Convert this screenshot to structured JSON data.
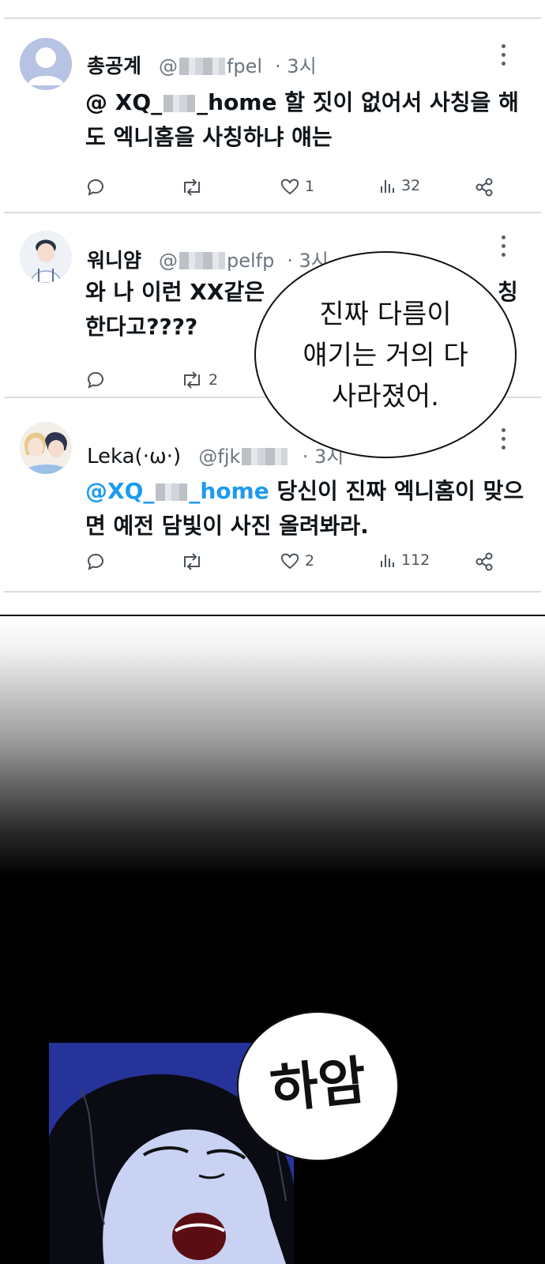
{
  "tweets": [
    {
      "name": "총공계",
      "handle_prefix": "@",
      "handle_suffix": "fpel",
      "time": "· 3시",
      "text_prefix": "@ XQ_",
      "text_mention_suffix": "_home",
      "text_body": " 할 짓이 없어서 사칭을 해도 엑니홈을 사칭하냐 얘는",
      "replies": "",
      "retweets": "",
      "likes": "1",
      "views": "32"
    },
    {
      "name": "워니얌",
      "handle_prefix": "@",
      "handle_suffix": "pelfp",
      "time": "· 3시",
      "text_line1": "와 나 이런 XX같은 ",
      "text_line1_end": "칭",
      "text_line2": "한다고????",
      "replies": "",
      "retweets": "2",
      "likes": "",
      "views": ""
    },
    {
      "name": "Leka(·ω·)",
      "handle_prefix": "@fjk",
      "handle_suffix": "",
      "time": "· 3시",
      "mention_prefix": "@XQ_",
      "mention_suffix": "_home",
      "text_body": " 당신이 진짜 엑니홈이 맞으면 예전 담빛이 사진 올려봐라.",
      "replies": "",
      "retweets": "",
      "likes": "2",
      "views": "112"
    }
  ],
  "speech_bubble": {
    "lines": [
      "진짜 다름이",
      "얘기는 거의 다",
      "사라졌어."
    ]
  },
  "sound_effect": "하암",
  "icons": {
    "reply": "reply-icon",
    "retweet": "retweet-icon",
    "like": "heart-icon",
    "views": "views-icon",
    "share": "share-icon",
    "more": "more-vertical-icon"
  },
  "colors": {
    "mention": "#1d9bf0",
    "divider": "#dadde1",
    "scene_blue": "#2c3aa8"
  }
}
